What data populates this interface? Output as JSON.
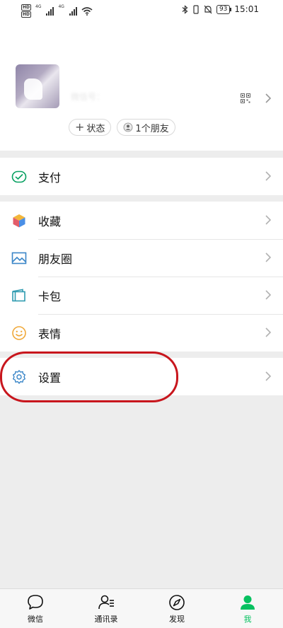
{
  "status_bar": {
    "hd1": "HD",
    "hd2": "HD",
    "net1": "4G",
    "net2": "4G",
    "battery": "93",
    "time": "15:01",
    "icons": [
      "bluetooth-icon",
      "vibrate-icon",
      "mute-bell-icon",
      "wifi-icon"
    ]
  },
  "profile": {
    "nickname": "",
    "wechat_id_label": "微信号：",
    "status_tag": "状态",
    "friends_tag": "1个朋友"
  },
  "menu": {
    "pay": "支付",
    "favorites": "收藏",
    "moments": "朋友圈",
    "cards": "卡包",
    "stickers": "表情",
    "settings": "设置"
  },
  "tabs": [
    {
      "label": "微信",
      "icon": "chat-bubble-icon"
    },
    {
      "label": "通讯录",
      "icon": "contacts-icon"
    },
    {
      "label": "发现",
      "icon": "compass-icon"
    },
    {
      "label": "我",
      "icon": "person-icon"
    }
  ],
  "colors": {
    "accent": "#07c160",
    "highlight_ring": "#c8161d",
    "background": "#ededed"
  }
}
